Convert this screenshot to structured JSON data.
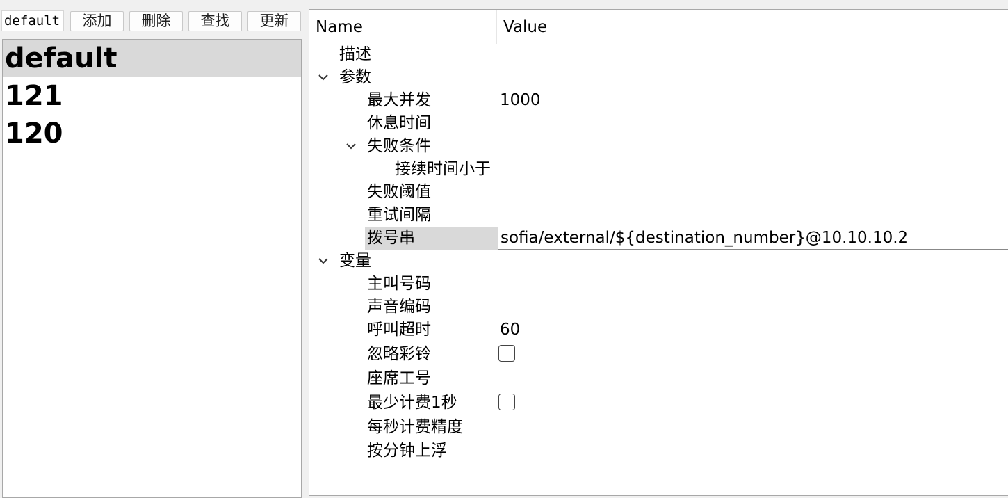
{
  "toolbar": {
    "name_value": "default",
    "add_label": "添加",
    "delete_label": "删除",
    "find_label": "查找",
    "update_label": "更新"
  },
  "list": {
    "items": [
      "default",
      "121",
      "120"
    ],
    "selected": "default"
  },
  "tree": {
    "header": {
      "name": "Name",
      "value": "Value"
    },
    "rows": {
      "desc": {
        "label": "描述"
      },
      "params": {
        "label": "参数",
        "expanded": true
      },
      "max_concurrency": {
        "label": "最大并发",
        "value": "1000"
      },
      "rest_time": {
        "label": "休息时间"
      },
      "fail_condition": {
        "label": "失败条件",
        "expanded": true
      },
      "duration_less_than": {
        "label": "接续时间小于"
      },
      "fail_threshold": {
        "label": "失败阈值"
      },
      "retry_interval": {
        "label": "重试间隔"
      },
      "dial_string": {
        "label": "拨号串",
        "value": "sofia/external/${destination_number}@10.10.10.2"
      },
      "variables": {
        "label": "变量",
        "expanded": true
      },
      "caller_number": {
        "label": "主叫号码"
      },
      "audio_codec": {
        "label": "声音编码"
      },
      "call_timeout": {
        "label": "呼叫超时",
        "value": "60"
      },
      "ignore_ringback": {
        "label": "忽略彩铃",
        "checked": false
      },
      "agent_id": {
        "label": "座席工号"
      },
      "min_billing_1s": {
        "label": "最少计费1秒",
        "checked": false
      },
      "per_second_precision": {
        "label": "每秒计费精度"
      },
      "round_up_minute": {
        "label": "按分钟上浮"
      }
    }
  },
  "colors": {
    "background": "#f0f0f0",
    "selection": "#d9d9d9",
    "border": "#a8a8a8"
  }
}
